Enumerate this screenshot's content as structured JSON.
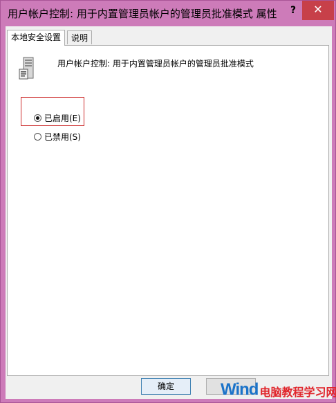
{
  "window": {
    "title": "用户帐户控制: 用于内置管理员帐户的管理员批准模式 属性",
    "help_label": "?",
    "close_label": "✕"
  },
  "tabs": [
    {
      "label": "本地安全设置",
      "active": true
    },
    {
      "label": "说明",
      "active": false
    }
  ],
  "policy": {
    "icon": "server-policy-icon",
    "title": "用户帐户控制: 用于内置管理员帐户的管理员批准模式"
  },
  "options": [
    {
      "label": "已启用(E)",
      "checked": true
    },
    {
      "label": "已禁用(S)",
      "checked": false
    }
  ],
  "buttons": {
    "ok_label": "确定"
  },
  "watermark": {
    "brand": "Wind",
    "site": "电脑教程学习网"
  },
  "colors": {
    "title_bar": "#cd7bb9",
    "close_button": "#c74049",
    "highlight_border": "#cc2a2a",
    "ok_border": "#3c7fb1"
  }
}
